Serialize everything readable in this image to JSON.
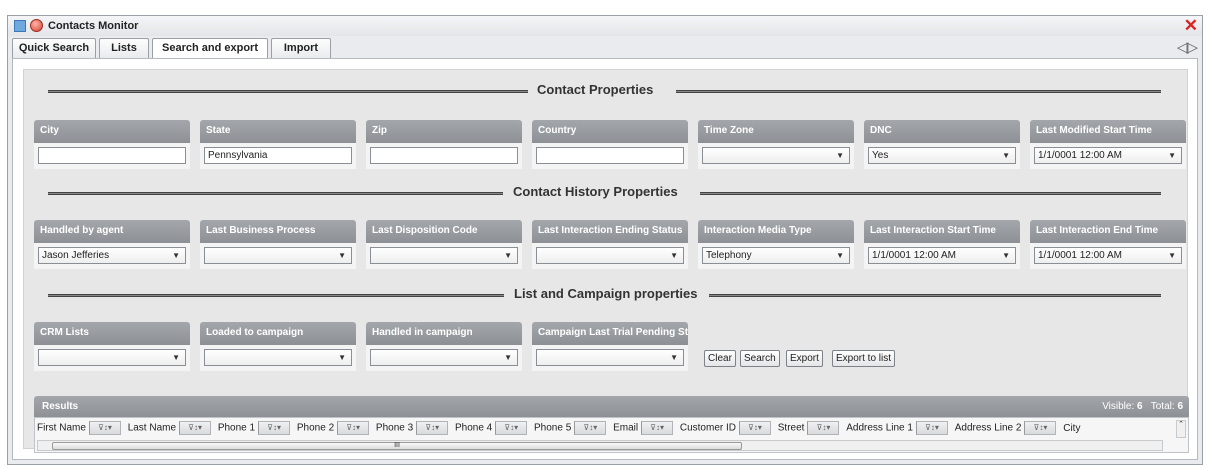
{
  "window": {
    "title": "Contacts Monitor",
    "close": "✕"
  },
  "tabs": [
    "Quick Search",
    "Lists",
    "Search and export",
    "Import"
  ],
  "nav_arrows": "◁▷",
  "sections": {
    "contact": "Contact Properties",
    "history": "Contact History Properties",
    "campaign": "List and Campaign properties"
  },
  "contact_fields": [
    {
      "label": "City",
      "value": ""
    },
    {
      "label": "State",
      "value": "Pennsylvania"
    },
    {
      "label": "Zip",
      "value": ""
    },
    {
      "label": "Country",
      "value": ""
    },
    {
      "label": "Time Zone",
      "value": ""
    },
    {
      "label": "DNC",
      "value": "Yes"
    },
    {
      "label": "Last Modified Start Time",
      "value": "1/1/0001 12:00 AM"
    }
  ],
  "history_fields": [
    {
      "label": "Handled by agent",
      "value": "Jason Jefferies"
    },
    {
      "label": "Last Business Process",
      "value": ""
    },
    {
      "label": "Last Disposition Code",
      "value": ""
    },
    {
      "label": "Last Interaction Ending Status",
      "value": ""
    },
    {
      "label": "Interaction Media Type",
      "value": "Telephony"
    },
    {
      "label": "Last Interaction Start Time",
      "value": "1/1/0001 12:00 AM"
    },
    {
      "label": "Last Interaction End Time",
      "value": "1/1/0001 12:00 AM"
    }
  ],
  "campaign_fields": [
    {
      "label": "CRM Lists",
      "value": ""
    },
    {
      "label": "Loaded to campaign",
      "value": ""
    },
    {
      "label": "Handled in campaign",
      "value": ""
    },
    {
      "label": "Campaign Last Trial Pending Sta",
      "value": ""
    }
  ],
  "buttons": {
    "clear": "Clear",
    "search": "Search",
    "export": "Export",
    "export_to_list": "Export to list"
  },
  "results": {
    "title": "Results",
    "visible_label": "Visible:",
    "visible": "6",
    "total_label": "Total:",
    "total": "6",
    "columns": [
      "First Name",
      "Last Name",
      "Phone 1",
      "Phone 2",
      "Phone 3",
      "Phone 4",
      "Phone 5",
      "Email",
      "Customer ID",
      "Street",
      "Address Line 1",
      "Address Line 2",
      "City"
    ],
    "scroll_thumb": "III"
  },
  "colors": {
    "label_bg": "#9a9ea2",
    "close": "#dd2222"
  }
}
